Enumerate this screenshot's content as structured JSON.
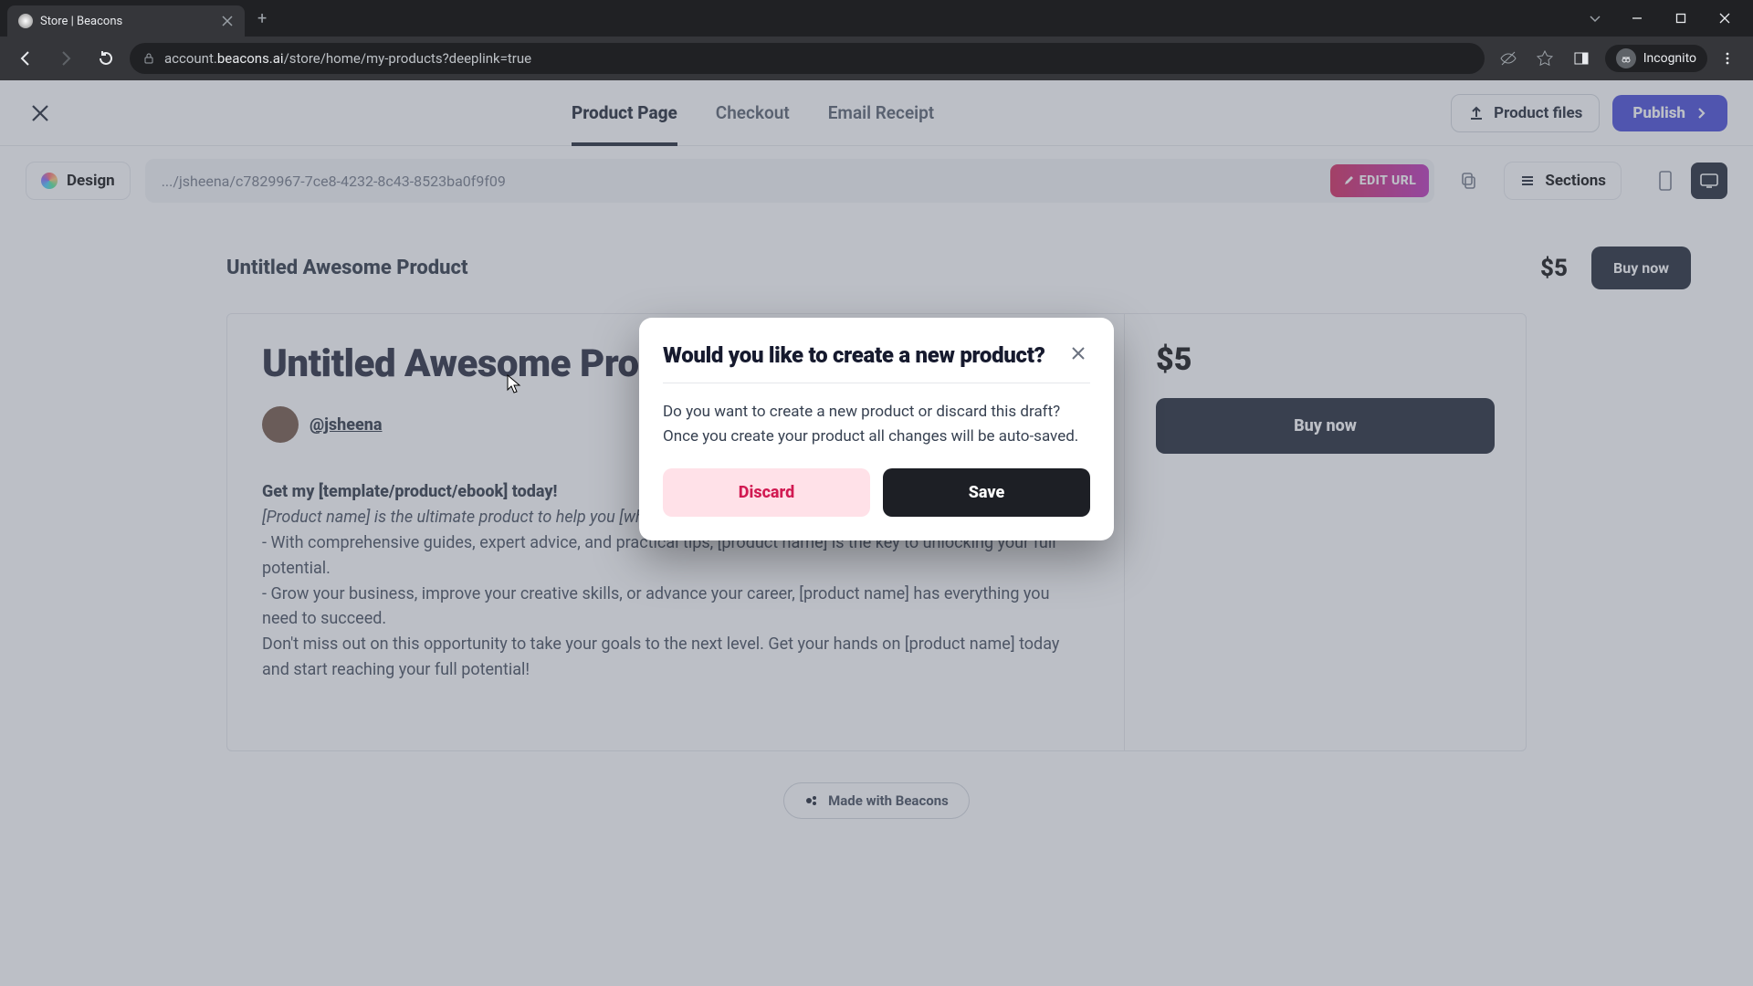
{
  "browser": {
    "tab_title": "Store | Beacons",
    "url_display_prefix": "account.",
    "url_display_domain": "beacons.ai",
    "url_display_path": "/store/home/my-products?deeplink=true",
    "incognito_label": "Incognito"
  },
  "topbar": {
    "tabs": {
      "product_page": "Product Page",
      "checkout": "Checkout",
      "email_receipt": "Email Receipt"
    },
    "product_files": "Product files",
    "publish": "Publish"
  },
  "toolbar": {
    "design": "Design",
    "page_url": ".../jsheena/c7829967-7ce8-4232-8c43-8523ba0f9f09",
    "edit_url": "EDIT URL",
    "sections": "Sections"
  },
  "sticky": {
    "title": "Untitled Awesome Product",
    "price": "$5",
    "buy": "Buy now"
  },
  "product": {
    "title": "Untitled Awesome Product",
    "handle": "@jsheena",
    "price": "$5",
    "buy": "Buy now",
    "desc_lead": "Get my [template/product/ebook] today!",
    "desc_ital": "[Product name] is the ultimate product to help you [what does it help you do].",
    "desc_b1": "- With comprehensive guides, expert advice, and practical tips, [product name] is the key to unlocking your full potential.",
    "desc_b2": "- Grow your business, improve your creative skills, or advance your career, [product name] has everything you need to succeed.",
    "desc_out": "Don't miss out on this opportunity to take your goals to the next level. Get your hands on [product name] today and start reaching your full potential!"
  },
  "footer": {
    "made_with": "Made with Beacons"
  },
  "modal": {
    "title": "Would you like to create a new product?",
    "body": "Do you want to create a new product or discard this draft? Once you create your product all changes will be auto-saved.",
    "discard": "Discard",
    "save": "Save"
  }
}
